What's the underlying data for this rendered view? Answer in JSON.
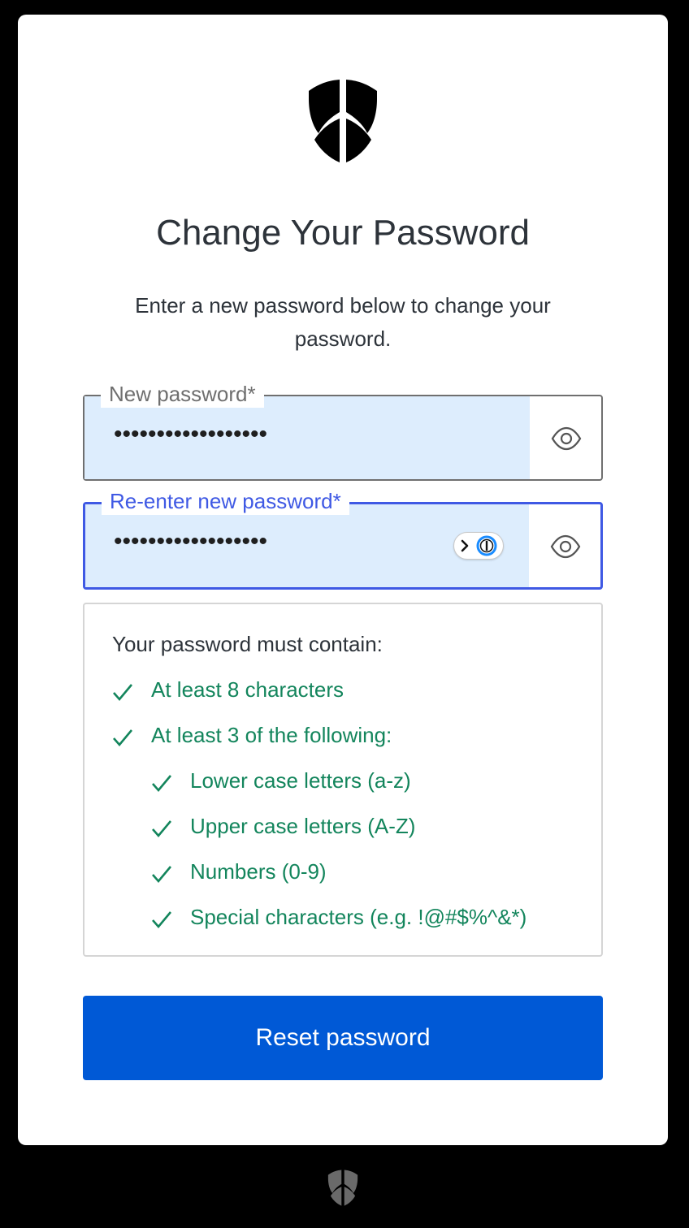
{
  "header": {
    "logo_icon": "shield-logo-icon",
    "title": "Change Your Password",
    "subtitle": "Enter a new password below to change your password."
  },
  "form": {
    "new_password": {
      "label": "New password",
      "required_mark": "*",
      "value": "••••••••••••••••••",
      "toggle_icon": "eye-icon"
    },
    "confirm_password": {
      "label": "Re-enter new password",
      "required_mark": "*",
      "value": "••••••••••••••••••",
      "focused": true,
      "password_manager_icon": "password-manager-badge-icon",
      "toggle_icon": "eye-icon"
    }
  },
  "requirements": {
    "title": "Your password must contain:",
    "items": [
      {
        "label": "At least 8 characters",
        "met": true,
        "level": 0
      },
      {
        "label": "At least 3 of the following:",
        "met": true,
        "level": 0
      },
      {
        "label": "Lower case letters (a-z)",
        "met": true,
        "level": 1
      },
      {
        "label": "Upper case letters (A-Z)",
        "met": true,
        "level": 1
      },
      {
        "label": "Numbers (0-9)",
        "met": true,
        "level": 1
      },
      {
        "label": "Special characters (e.g. !@#$%^&*)",
        "met": true,
        "level": 1
      }
    ]
  },
  "actions": {
    "reset_label": "Reset password"
  },
  "footer": {
    "logo_icon": "shield-logo-icon"
  },
  "colors": {
    "primary_button": "#0059d6",
    "focus_border": "#3f59e4",
    "autofill_background": "#ddedfd",
    "success_green": "#13855c",
    "text_dark": "#2d333a"
  }
}
